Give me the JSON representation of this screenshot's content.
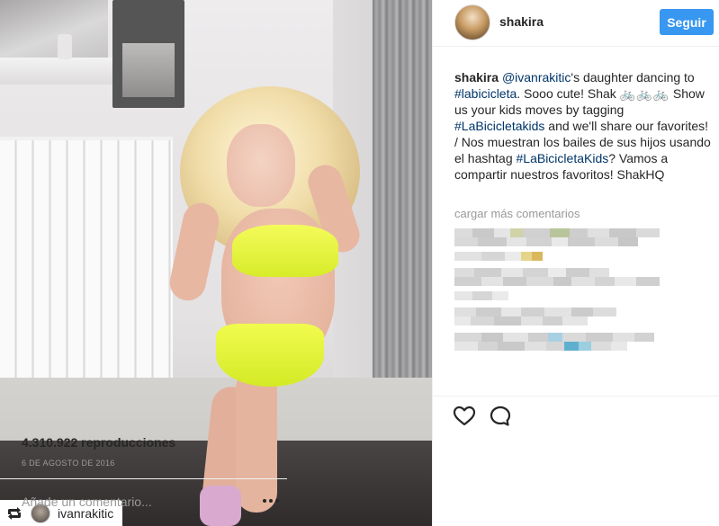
{
  "media": {
    "reposted_from": "ivanrakitic",
    "retweet_icon": "repost-icon"
  },
  "header": {
    "username": "shakira",
    "follow_label": "Seguir",
    "accent": "#3897f0"
  },
  "caption": {
    "username": "shakira",
    "mention": "@ivanrakitic",
    "text_1": "'s daughter dancing to ",
    "hashtag_1": "#labicicleta",
    "text_2": ". Sooo cute! Shak ",
    "bikes": "🚲🚲🚲",
    "text_3": " Show us your kids moves by tagging ",
    "hashtag_2": "#LaBicicletakids",
    "text_4": " and we'll share our favorites! / Nos muestran los bailes de sus hijos usando el hashtag ",
    "hashtag_3": "#LaBicicletaKids",
    "text_5": "? Vamos a compartir nuestros favoritos! ShakHQ"
  },
  "comments": {
    "load_more": "cargar más comentarios"
  },
  "actions": {
    "like_icon": "heart-icon",
    "comment_icon": "comment-icon",
    "views": "4.310.922 reproducciones",
    "date": "6 DE AGOSTO DE 2016"
  },
  "comment_input": {
    "placeholder": "Añade un comentario...",
    "more_icon": "more-options-icon"
  }
}
